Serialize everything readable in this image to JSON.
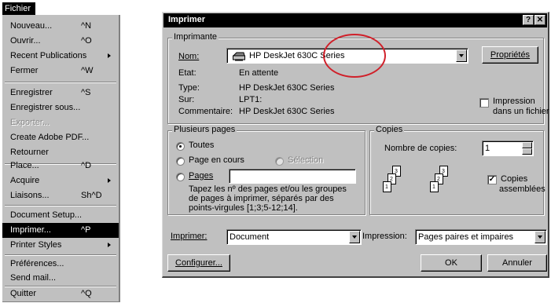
{
  "menu": {
    "title": "Fichier",
    "items": [
      {
        "label": "Nouveau...",
        "shortcut": "^N"
      },
      {
        "label": "Ouvrir...",
        "shortcut": "^O"
      },
      {
        "label": "Recent Publications",
        "shortcut": ""
      },
      {
        "label": "Fermer",
        "shortcut": "^W"
      },
      {
        "label": "Enregistrer",
        "shortcut": "^S"
      },
      {
        "label": "Enregistrer sous...",
        "shortcut": ""
      },
      {
        "label": "Exporter...",
        "shortcut": ""
      },
      {
        "label": "Create Adobe PDF...",
        "shortcut": ""
      },
      {
        "label": "Retourner",
        "shortcut": ""
      },
      {
        "label": "Place...",
        "shortcut": "^D"
      },
      {
        "label": "Acquire",
        "shortcut": ""
      },
      {
        "label": "Liaisons...",
        "shortcut": "Sh^D"
      },
      {
        "label": "Document Setup...",
        "shortcut": ""
      },
      {
        "label": "Imprimer...",
        "shortcut": "^P"
      },
      {
        "label": "Printer Styles",
        "shortcut": ""
      },
      {
        "label": "Préférences...",
        "shortcut": ""
      },
      {
        "label": "Send mail...",
        "shortcut": ""
      },
      {
        "label": "Quitter",
        "shortcut": "^Q"
      }
    ]
  },
  "dialog": {
    "title": "Imprimer",
    "help_glyph": "?",
    "close_glyph": "✕",
    "printer_group": {
      "legend": "Imprimante",
      "name_label": "Nom:",
      "name_value": "HP DeskJet 630C Series",
      "properties_button": "Propriétés",
      "status_label": "Etat:",
      "status_value": "En attente",
      "type_label": "Type:",
      "type_value": "HP DeskJet 630C Series",
      "where_label": "Sur:",
      "where_value": "LPT1:",
      "comment_label": "Commentaire:",
      "comment_value": "HP DeskJet 630C Series",
      "print_to_file_line1": "Impression",
      "print_to_file_line2": "dans un fichier",
      "print_to_file_checked": false
    },
    "pages_group": {
      "legend": "Plusieurs pages",
      "all": "Toutes",
      "current": "Page en cours",
      "selection": "Sélection",
      "pages": "Pages",
      "pages_value": "",
      "selected_option": "all",
      "help_line1": "Tapez les nº des pages et/ou les groupes",
      "help_line2": "de pages à imprimer, séparés par des",
      "help_line3": "points-virgules [1;3;5-12;14]."
    },
    "copies_group": {
      "legend": "Copies",
      "count_label": "Nombre de copies:",
      "count_value": "1",
      "collate_line1": "Copies",
      "collate_line2": "assemblées",
      "collate_checked": true,
      "collate_check_glyph": "✓",
      "page_numbers": [
        "1",
        "2",
        "3"
      ]
    },
    "print_what_label": "Imprimer:",
    "print_what_value": "Document",
    "print_range_label": "Impression:",
    "print_range_value": "Pages paires et impaires",
    "configure_button": "Configurer...",
    "ok_button": "OK",
    "cancel_button": "Annuler"
  },
  "colors": {
    "highlight_ellipse": "#d0202a",
    "dialog_face": "#c0c0c0",
    "title_bar": "#000000"
  },
  "icons": {
    "printer": "printer-icon",
    "submenu": "chevron-right-icon",
    "dropdown": "chevron-down-icon",
    "spinner_up": "caret-up-icon",
    "spinner_down": "caret-down-icon"
  }
}
